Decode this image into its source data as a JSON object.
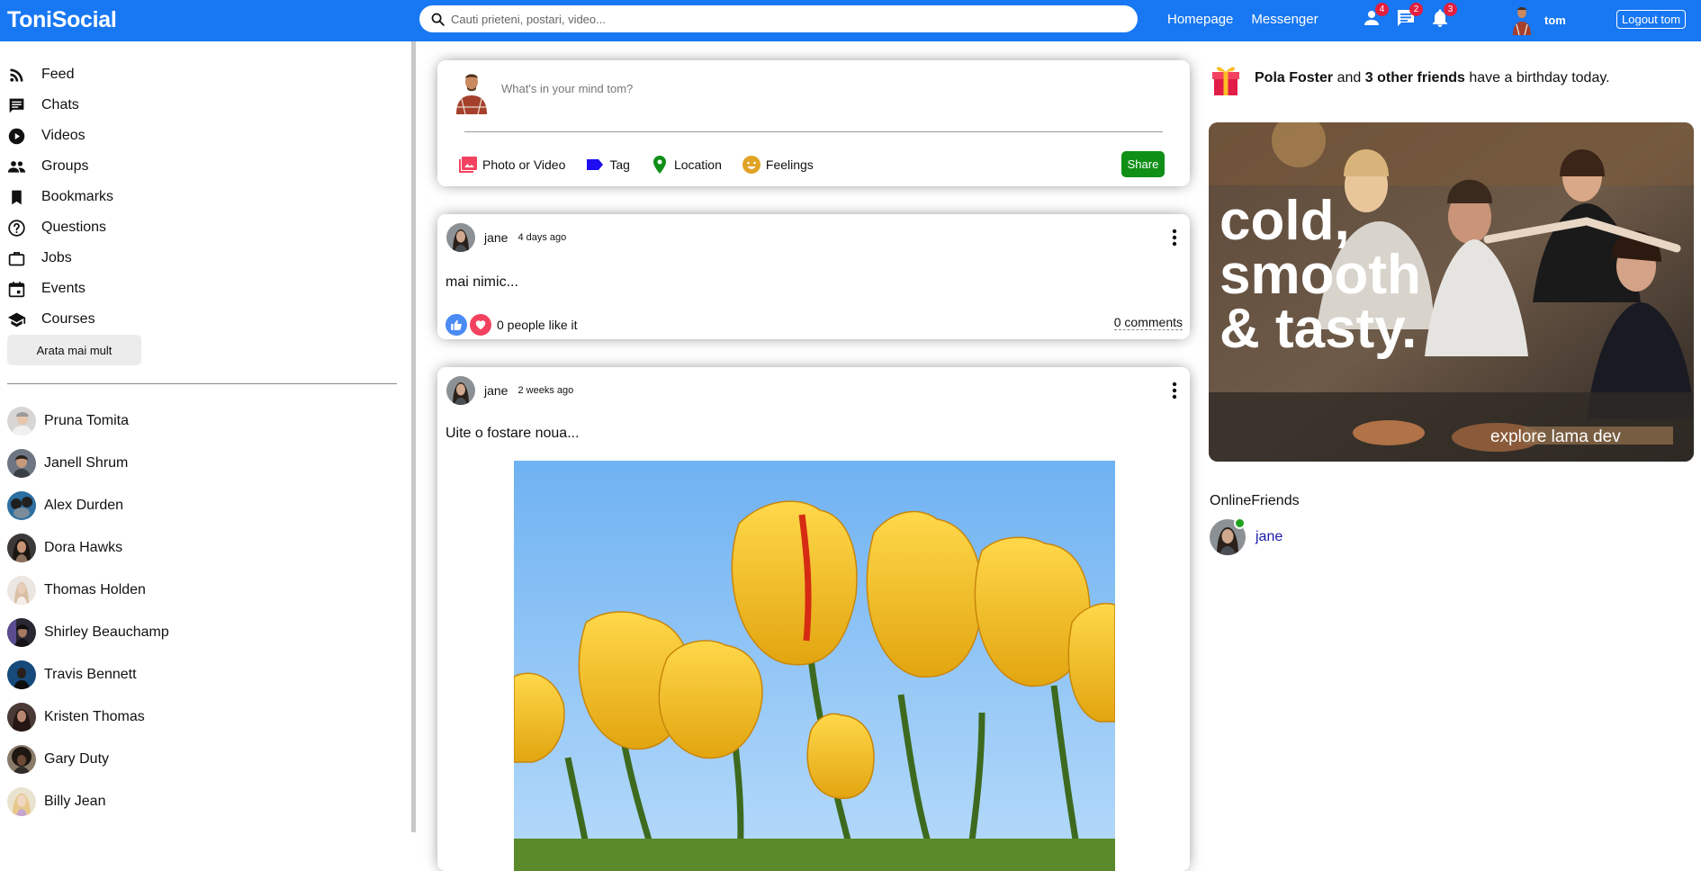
{
  "topbar": {
    "logo": "ToniSocial",
    "search_placeholder": "Cauti prieteni, postari, video...",
    "links": [
      "Homepage",
      "Messenger"
    ],
    "notifications": {
      "friends": "4",
      "messages": "2",
      "alerts": "3"
    },
    "username": "tom",
    "logout_label": "Logout tom"
  },
  "sidebar": {
    "items": [
      {
        "label": "Feed",
        "icon": "rss-feed-icon"
      },
      {
        "label": "Chats",
        "icon": "chat-icon"
      },
      {
        "label": "Videos",
        "icon": "play-circle-icon"
      },
      {
        "label": "Groups",
        "icon": "groups-icon"
      },
      {
        "label": "Bookmarks",
        "icon": "bookmark-icon"
      },
      {
        "label": "Questions",
        "icon": "help-outline-icon"
      },
      {
        "label": "Jobs",
        "icon": "work-outline-icon"
      },
      {
        "label": "Events",
        "icon": "event-icon"
      },
      {
        "label": "Courses",
        "icon": "school-icon"
      }
    ],
    "more_label": "Arata mai mult",
    "friends": [
      "Pruna Tomita",
      "Janell Shrum",
      "Alex Durden",
      "Dora Hawks",
      "Thomas Holden",
      "Shirley Beauchamp",
      "Travis Bennett",
      "Kristen Thomas",
      "Gary Duty",
      "Billy Jean"
    ]
  },
  "share": {
    "placeholder": "What's in your mind tom?",
    "options": [
      {
        "label": "Photo or Video",
        "color": "#f3425f"
      },
      {
        "label": "Tag",
        "color": "#1d0df0"
      },
      {
        "label": "Location",
        "color": "#108f17"
      },
      {
        "label": "Feelings",
        "color": "#e1a325"
      }
    ],
    "button": "Share"
  },
  "posts": [
    {
      "user": "jane",
      "date": "4 days ago",
      "text": "mai nimic...",
      "likes": "0 people like it",
      "comments": "0 comments"
    },
    {
      "user": "jane",
      "date": "2 weeks ago",
      "text": "Uite o fostare noua..."
    }
  ],
  "rightbar": {
    "birthday": {
      "name": "Pola Foster",
      "connector": "and",
      "others": "3 other friends",
      "suffix": "have a birthday today."
    },
    "ad": {
      "line1": "cold,",
      "line2": "smooth",
      "line3": "& tasty.",
      "tag": "explore lama dev"
    },
    "online_title": "OnlineFriends",
    "online_friends": [
      "jane"
    ]
  }
}
